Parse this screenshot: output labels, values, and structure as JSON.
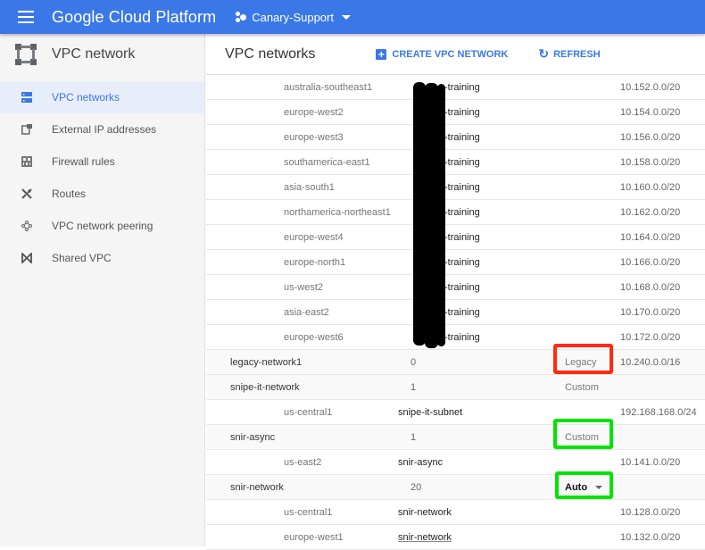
{
  "topbar": {
    "brand": "Google Cloud Platform",
    "project": "Canary-Support",
    "accent": "#3b78e7"
  },
  "sidebar": {
    "title": "VPC network",
    "items": [
      {
        "label": "VPC networks",
        "icon": "vpc-networks-icon",
        "active": true
      },
      {
        "label": "External IP addresses",
        "icon": "external-ip-icon",
        "active": false
      },
      {
        "label": "Firewall rules",
        "icon": "firewall-icon",
        "active": false
      },
      {
        "label": "Routes",
        "icon": "routes-icon",
        "active": false
      },
      {
        "label": "VPC network peering",
        "icon": "peering-icon",
        "active": false
      },
      {
        "label": "Shared VPC",
        "icon": "shared-vpc-icon",
        "active": false
      }
    ]
  },
  "main": {
    "title": "VPC networks",
    "create_label": "CREATE VPC NETWORK",
    "refresh_label": "REFRESH"
  },
  "rows": [
    {
      "type": "subnet",
      "region": "australia-southeast1",
      "subnet": "-training",
      "cidr": "10.152.0.0/20",
      "redacted": true
    },
    {
      "type": "subnet",
      "region": "europe-west2",
      "subnet": "-training",
      "cidr": "10.154.0.0/20",
      "redacted": true
    },
    {
      "type": "subnet",
      "region": "europe-west3",
      "subnet": "-training",
      "cidr": "10.156.0.0/20",
      "redacted": true
    },
    {
      "type": "subnet",
      "region": "southamerica-east1",
      "subnet": "-training",
      "cidr": "10.158.0.0/20",
      "redacted": true
    },
    {
      "type": "subnet",
      "region": "asia-south1",
      "subnet": "-training",
      "cidr": "10.160.0.0/20",
      "redacted": true
    },
    {
      "type": "subnet",
      "region": "northamerica-northeast1",
      "subnet": "-training",
      "cidr": "10.162.0.0/20",
      "redacted": true
    },
    {
      "type": "subnet",
      "region": "europe-west4",
      "subnet": "-training",
      "cidr": "10.164.0.0/20",
      "redacted": true
    },
    {
      "type": "subnet",
      "region": "europe-north1",
      "subnet": "-training",
      "cidr": "10.166.0.0/20",
      "redacted": true
    },
    {
      "type": "subnet",
      "region": "us-west2",
      "subnet": "-training",
      "cidr": "10.168.0.0/20",
      "redacted": true
    },
    {
      "type": "subnet",
      "region": "asia-east2",
      "subnet": "-training",
      "cidr": "10.170.0.0/20",
      "redacted": true
    },
    {
      "type": "subnet",
      "region": "europe-west6",
      "subnet": "-training",
      "cidr": "10.172.0.0/20",
      "redacted": true
    },
    {
      "type": "network",
      "name": "legacy-network1",
      "count": "0",
      "mode": "Legacy",
      "cidr": "10.240.0.0/16",
      "highlight": "red"
    },
    {
      "type": "network",
      "name": "snipe-it-network",
      "count": "1",
      "mode": "Custom",
      "cidr": ""
    },
    {
      "type": "subnet",
      "region": "us-central1",
      "subnet": "snipe-it-subnet",
      "cidr": "192.168.168.0/24"
    },
    {
      "type": "network",
      "name": "snir-async",
      "count": "1",
      "mode": "Custom",
      "cidr": "",
      "highlight": "green"
    },
    {
      "type": "subnet",
      "region": "us-east2",
      "subnet": "snir-async",
      "cidr": "10.141.0.0/20"
    },
    {
      "type": "network",
      "name": "snir-network",
      "count": "20",
      "mode": "Auto",
      "cidr": "",
      "highlight": "green",
      "dropdown": true
    },
    {
      "type": "subnet",
      "region": "us-central1",
      "subnet": "snir-network",
      "cidr": "10.128.0.0/20"
    },
    {
      "type": "subnet",
      "region": "europe-west1",
      "subnet": "snir-network",
      "cidr": "10.132.0.0/20",
      "underline": true
    }
  ]
}
